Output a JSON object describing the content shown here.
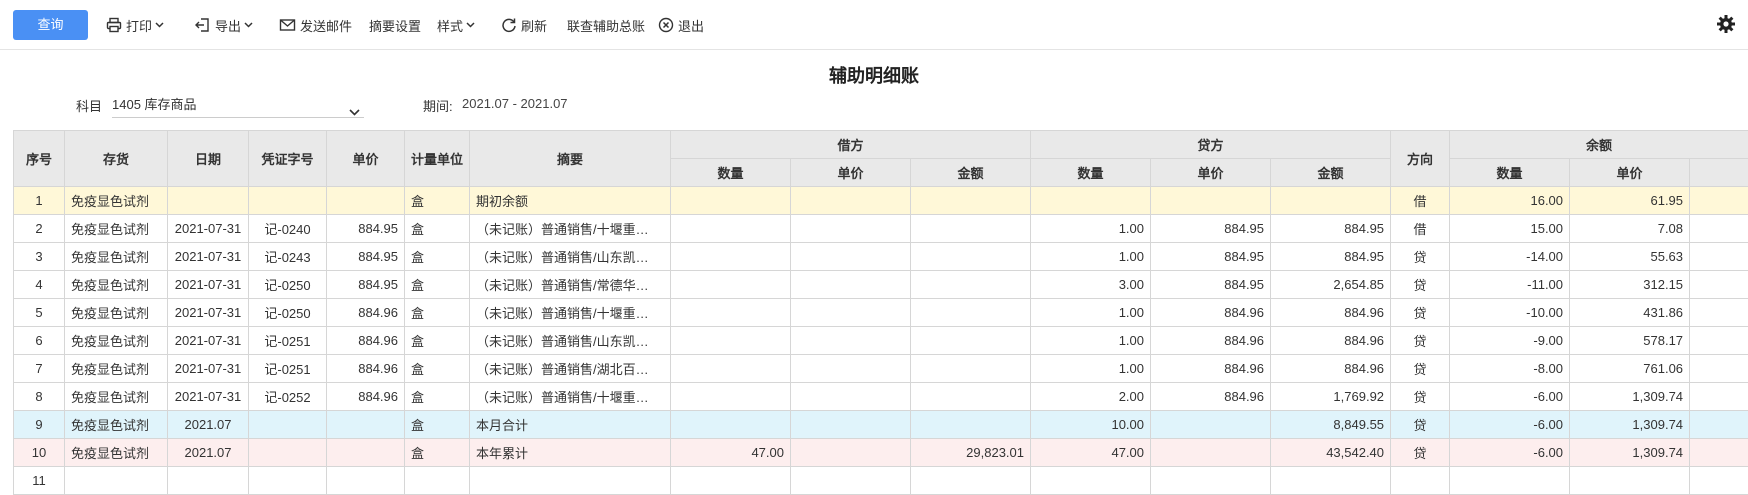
{
  "toolbar": {
    "query_label": "查询",
    "print_label": "打印",
    "export_label": "导出",
    "send_mail_label": "发送邮件",
    "summary_settings_label": "摘要设置",
    "style_label": "样式",
    "refresh_label": "刷新",
    "linked_query_label": "联查辅助总账",
    "exit_label": "退出"
  },
  "page": {
    "title": "辅助明细账",
    "subject_label": "科目",
    "subject_value": "1405 库存商品",
    "period_label": "期间:",
    "period_value": "2021.07 - 2021.07"
  },
  "table": {
    "headers": {
      "seq": "序号",
      "inventory": "存货",
      "date": "日期",
      "voucher": "凭证字号",
      "unit_price": "单价",
      "unit": "计量单位",
      "summary": "摘要",
      "debit": "借方",
      "credit": "贷方",
      "direction": "方向",
      "balance": "余额",
      "qty": "数量",
      "price": "单价",
      "amount": "金额"
    },
    "rows": [
      {
        "seq": "1",
        "inventory": "免疫显色试剂",
        "date": "",
        "voucher": "",
        "unit_price": "",
        "unit": "盒",
        "summary": "期初余额",
        "d_qty": "",
        "d_price": "",
        "d_amt": "",
        "c_qty": "",
        "c_price": "",
        "c_amt": "",
        "dir": "借",
        "b_qty": "16.00",
        "b_price": "61.95",
        "b_neg": false,
        "kind": "opening"
      },
      {
        "seq": "2",
        "inventory": "免疫显色试剂",
        "date": "2021-07-31",
        "voucher": "记-0240",
        "unit_price": "884.95",
        "unit": "盒",
        "summary": "（未记账）普通销售/十堰重…",
        "d_qty": "",
        "d_price": "",
        "d_amt": "",
        "c_qty": "1.00",
        "c_price": "884.95",
        "c_amt": "884.95",
        "dir": "借",
        "b_qty": "15.00",
        "b_price": "7.08",
        "b_neg": false,
        "kind": "normal"
      },
      {
        "seq": "3",
        "inventory": "免疫显色试剂",
        "date": "2021-07-31",
        "voucher": "记-0243",
        "unit_price": "884.95",
        "unit": "盒",
        "summary": "（未记账）普通销售/山东凯…",
        "d_qty": "",
        "d_price": "",
        "d_amt": "",
        "c_qty": "1.00",
        "c_price": "884.95",
        "c_amt": "884.95",
        "dir": "贷",
        "b_qty": "-14.00",
        "b_price": "55.63",
        "b_neg": true,
        "kind": "normal"
      },
      {
        "seq": "4",
        "inventory": "免疫显色试剂",
        "date": "2021-07-31",
        "voucher": "记-0250",
        "unit_price": "884.95",
        "unit": "盒",
        "summary": "（未记账）普通销售/常德华…",
        "d_qty": "",
        "d_price": "",
        "d_amt": "",
        "c_qty": "3.00",
        "c_price": "884.95",
        "c_amt": "2,654.85",
        "dir": "贷",
        "b_qty": "-11.00",
        "b_price": "312.15",
        "b_neg": true,
        "kind": "normal"
      },
      {
        "seq": "5",
        "inventory": "免疫显色试剂",
        "date": "2021-07-31",
        "voucher": "记-0250",
        "unit_price": "884.96",
        "unit": "盒",
        "summary": "（未记账）普通销售/十堰重…",
        "d_qty": "",
        "d_price": "",
        "d_amt": "",
        "c_qty": "1.00",
        "c_price": "884.96",
        "c_amt": "884.96",
        "dir": "贷",
        "b_qty": "-10.00",
        "b_price": "431.86",
        "b_neg": true,
        "kind": "normal"
      },
      {
        "seq": "6",
        "inventory": "免疫显色试剂",
        "date": "2021-07-31",
        "voucher": "记-0251",
        "unit_price": "884.96",
        "unit": "盒",
        "summary": "（未记账）普通销售/山东凯…",
        "d_qty": "",
        "d_price": "",
        "d_amt": "",
        "c_qty": "1.00",
        "c_price": "884.96",
        "c_amt": "884.96",
        "dir": "贷",
        "b_qty": "-9.00",
        "b_price": "578.17",
        "b_neg": true,
        "kind": "normal"
      },
      {
        "seq": "7",
        "inventory": "免疫显色试剂",
        "date": "2021-07-31",
        "voucher": "记-0251",
        "unit_price": "884.96",
        "unit": "盒",
        "summary": "（未记账）普通销售/湖北百…",
        "d_qty": "",
        "d_price": "",
        "d_amt": "",
        "c_qty": "1.00",
        "c_price": "884.96",
        "c_amt": "884.96",
        "dir": "贷",
        "b_qty": "-8.00",
        "b_price": "761.06",
        "b_neg": true,
        "kind": "normal"
      },
      {
        "seq": "8",
        "inventory": "免疫显色试剂",
        "date": "2021-07-31",
        "voucher": "记-0252",
        "unit_price": "884.96",
        "unit": "盒",
        "summary": "（未记账）普通销售/十堰重…",
        "d_qty": "",
        "d_price": "",
        "d_amt": "",
        "c_qty": "2.00",
        "c_price": "884.96",
        "c_amt": "1,769.92",
        "dir": "贷",
        "b_qty": "-6.00",
        "b_price": "1,309.74",
        "b_neg": true,
        "kind": "normal"
      },
      {
        "seq": "9",
        "inventory": "免疫显色试剂",
        "date": "2021.07",
        "voucher": "",
        "unit_price": "",
        "unit": "盒",
        "summary": "本月合计",
        "d_qty": "",
        "d_price": "",
        "d_amt": "",
        "c_qty": "10.00",
        "c_price": "",
        "c_amt": "8,849.55",
        "dir": "贷",
        "b_qty": "-6.00",
        "b_price": "1,309.74",
        "b_neg": true,
        "kind": "month"
      },
      {
        "seq": "10",
        "inventory": "免疫显色试剂",
        "date": "2021.07",
        "voucher": "",
        "unit_price": "",
        "unit": "盒",
        "summary": "本年累计",
        "d_qty": "47.00",
        "d_price": "",
        "d_amt": "29,823.01",
        "c_qty": "47.00",
        "c_price": "",
        "c_amt": "43,542.40",
        "dir": "贷",
        "b_qty": "-6.00",
        "b_price": "1,309.74",
        "b_neg": true,
        "kind": "year"
      },
      {
        "seq": "11",
        "inventory": "",
        "date": "",
        "voucher": "",
        "unit_price": "",
        "unit": "",
        "summary": "",
        "d_qty": "",
        "d_price": "",
        "d_amt": "",
        "c_qty": "",
        "c_price": "",
        "c_amt": "",
        "dir": "",
        "b_qty": "",
        "b_price": "",
        "b_neg": false,
        "kind": "blank"
      }
    ]
  }
}
